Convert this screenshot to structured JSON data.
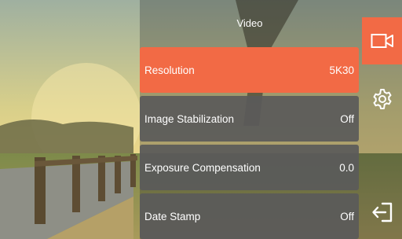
{
  "header": {
    "title": "Video"
  },
  "menu": {
    "items": [
      {
        "label": "Resolution",
        "value": "5K30",
        "selected": true
      },
      {
        "label": "Image Stabilization",
        "value": "Off",
        "selected": false
      },
      {
        "label": "Exposure Compensation",
        "value": "0.0",
        "selected": false
      },
      {
        "label": "Date Stamp",
        "value": "Off",
        "selected": false
      }
    ]
  },
  "sidebar": {
    "items": [
      {
        "icon": "video-camera-icon",
        "active": true
      },
      {
        "icon": "gear-icon",
        "active": false
      },
      {
        "icon": "exit-icon",
        "active": false
      }
    ]
  },
  "colors": {
    "accent": "#f26a45",
    "item_background": "#5a5a5a",
    "text": "#ffffff"
  }
}
